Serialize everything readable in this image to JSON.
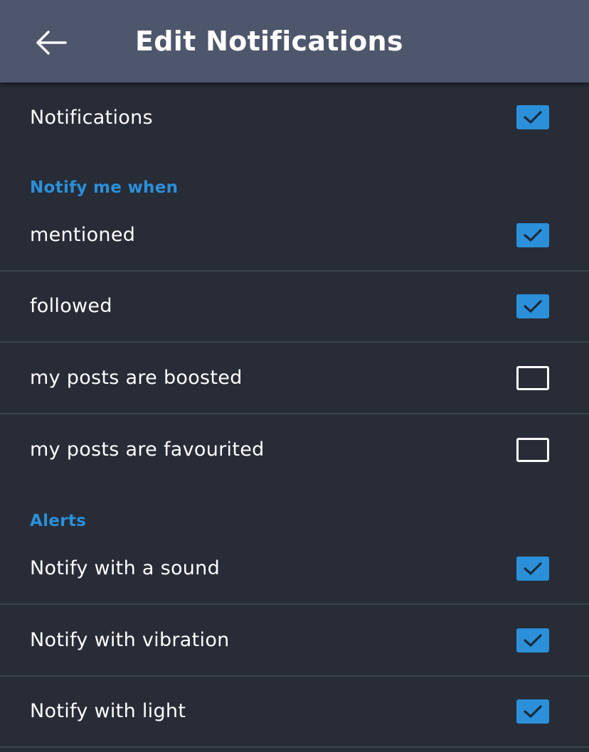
{
  "toolbar": {
    "title": "Edit Notifications",
    "back_icon": "arrow-left-icon",
    "background": "#4e566b"
  },
  "colors": {
    "background": "#282c37",
    "accent": "#2b90d9",
    "divider": "#3c4251",
    "text": "#ffffff"
  },
  "master": {
    "label": "Notifications",
    "checked": true
  },
  "sections": {
    "notify_header": "Notify me when",
    "alerts_header": "Alerts"
  },
  "notify_items": [
    {
      "label": "mentioned",
      "checked": true
    },
    {
      "label": "followed",
      "checked": true
    },
    {
      "label": "my posts are boosted",
      "checked": false
    },
    {
      "label": "my posts are favourited",
      "checked": false
    }
  ],
  "alert_items": [
    {
      "label": "Notify with a sound",
      "checked": true
    },
    {
      "label": "Notify with vibration",
      "checked": true
    },
    {
      "label": "Notify with light",
      "checked": true
    }
  ]
}
